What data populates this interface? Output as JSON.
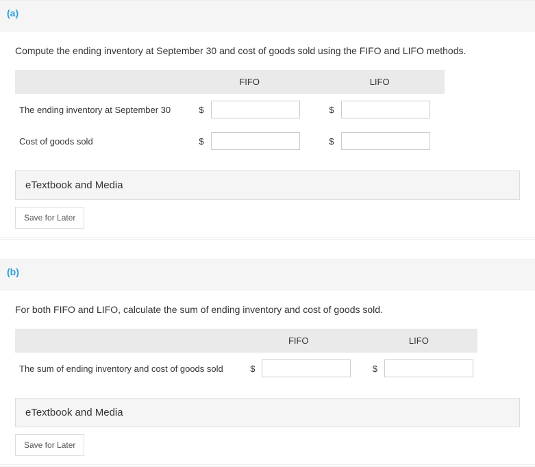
{
  "part_a": {
    "label": "(a)",
    "instruction": "Compute the ending inventory at September 30 and cost of goods sold using the FIFO and LIFO methods.",
    "columns": {
      "fifo": "FIFO",
      "lifo": "LIFO"
    },
    "rows": {
      "ending_inventory": {
        "label": "The ending inventory at September 30",
        "fifo_symbol": "$",
        "lifo_symbol": "$",
        "fifo_value": "",
        "lifo_value": ""
      },
      "cogs": {
        "label": "Cost of goods sold",
        "fifo_symbol": "$",
        "lifo_symbol": "$",
        "fifo_value": "",
        "lifo_value": ""
      }
    },
    "etextbook_label": "eTextbook and Media",
    "save_label": "Save for Later"
  },
  "part_b": {
    "label": "(b)",
    "instruction": "For both FIFO and LIFO, calculate the sum of ending inventory and cost of goods sold.",
    "columns": {
      "fifo": "FIFO",
      "lifo": "LIFO"
    },
    "rows": {
      "sum": {
        "label": "The sum of ending inventory and cost of goods sold",
        "fifo_symbol": "$",
        "lifo_symbol": "$",
        "fifo_value": "",
        "lifo_value": ""
      }
    },
    "etextbook_label": "eTextbook and Media",
    "save_label": "Save for Later"
  }
}
